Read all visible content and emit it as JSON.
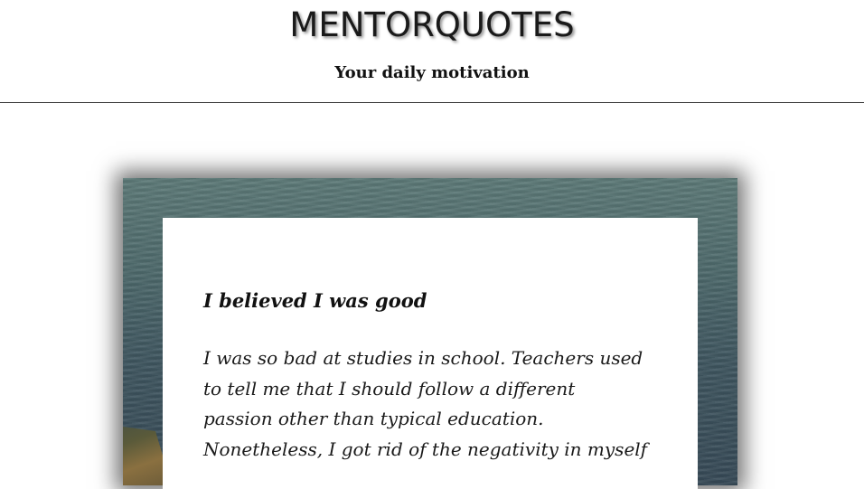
{
  "header": {
    "site_title": "MENTORQUOTES",
    "tagline": "Your daily motivation"
  },
  "quote": {
    "title": "I believed I was good",
    "lines": [
      "I was so bad at studies in school. Teachers used",
      "to tell me that I should follow a different",
      "passion other than typical education.",
      "Nonetheless, I got rid of the negativity in myself"
    ]
  },
  "colors": {
    "divider": "#333333",
    "sea": "#4e6a6c"
  }
}
